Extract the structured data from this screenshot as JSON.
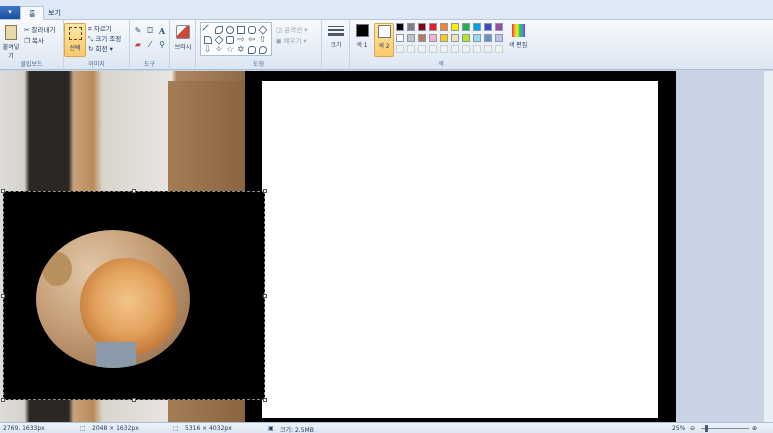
{
  "tabs": {
    "file": "▾",
    "home": "홈",
    "view": "보기"
  },
  "clipboard": {
    "paste": "붙여넣기",
    "cut": "잘라내기",
    "copy": "복사",
    "label": "클립보드"
  },
  "image": {
    "select": "선택",
    "crop": "자르기",
    "resize": "크기 조정",
    "rotate": "회전",
    "label": "이미지"
  },
  "tools": {
    "label": "도구"
  },
  "brushes": {
    "label": "브러시"
  },
  "shapes": {
    "outline": "윤곽선",
    "fill": "채우기",
    "label": "도형"
  },
  "size": {
    "label": "크기"
  },
  "colors": {
    "color1": "색 1",
    "color2": "색 2",
    "edit": "색 편집",
    "label": "색"
  },
  "palette": [
    "#000000",
    "#7f7f7f",
    "#880015",
    "#ed1c24",
    "#ff7f27",
    "#fff200",
    "#22b14c",
    "#00a2e8",
    "#3f48cc",
    "#a349a4",
    "#ffffff",
    "#c3c3c3",
    "#b97a57",
    "#ffaec9",
    "#ffc90e",
    "#efe4b0",
    "#b5e61d",
    "#99d9ea",
    "#7092be",
    "#c8bfe7"
  ],
  "status": {
    "cursor": "2769, 1633px",
    "selection": "2048 × 1632px",
    "image_size": "5316 × 4032px",
    "file_size": "크기: 2.5MB",
    "zoom": "25%"
  }
}
